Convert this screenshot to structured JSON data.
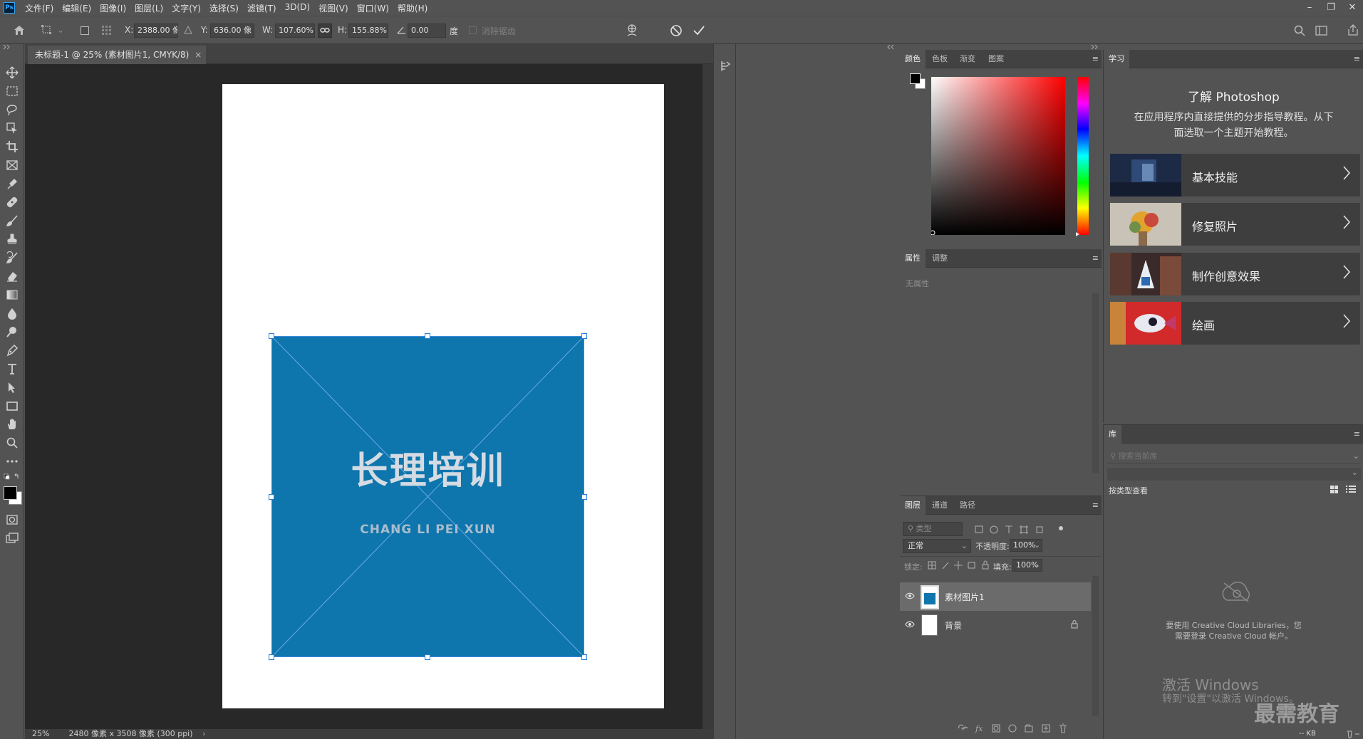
{
  "menubar": {
    "app_icon": "Ps",
    "items": [
      "文件(F)",
      "编辑(E)",
      "图像(I)",
      "图层(L)",
      "文字(Y)",
      "选择(S)",
      "滤镜(T)",
      "3D(D)",
      "视图(V)",
      "窗口(W)",
      "帮助(H)"
    ],
    "window_controls": [
      "minimize-icon",
      "restore-icon",
      "close-icon"
    ]
  },
  "options": {
    "x_label": "X:",
    "x_value": "2388.00 像",
    "y_label": "Y:",
    "y_value": "636.00 像",
    "w_label": "W:",
    "w_value": "107.60%",
    "h_label": "H:",
    "h_value": "155.88%",
    "angle_value": "0.00",
    "angle_unit": "度",
    "antialias_label": "消除锯齿"
  },
  "document": {
    "tab_title": "未标题-1 @ 25% (素材图片1, CMYK/8)",
    "logo_title": "长理培训",
    "logo_subtitle": "CHANG LI PEI XUN"
  },
  "status": {
    "zoom": "25%",
    "doc_info": "2480 像素 x 3508 像素 (300 ppi)"
  },
  "color_panel": {
    "tabs": [
      "颜色",
      "色板",
      "渐变",
      "图案"
    ],
    "foreground": "#000000",
    "background": "#ffffff",
    "hue": "#ff0000"
  },
  "properties_panel": {
    "tabs": [
      "属性",
      "调整"
    ],
    "empty_text": "无属性"
  },
  "layers_panel": {
    "tabs": [
      "图层",
      "通道",
      "路径"
    ],
    "filter_placeholder": "类型",
    "blend_mode": "正常",
    "opacity_label": "不透明度:",
    "opacity_value": "100%",
    "lock_label": "锁定:",
    "fill_label": "填充:",
    "fill_value": "100%",
    "layers": [
      {
        "name": "素材图片1",
        "selected": true
      },
      {
        "name": "背景",
        "selected": false,
        "locked": true
      }
    ]
  },
  "learn_panel": {
    "tab": "学习",
    "heading": "了解 Photoshop",
    "description_line1": "在应用程序内直接提供的分步指导教程。从下",
    "description_line2": "面选取一个主题开始教程。",
    "cards": [
      "基本技能",
      "修复照片",
      "制作创意效果",
      "绘画"
    ]
  },
  "library_panel": {
    "tab": "库",
    "search_placeholder": "搜索当前库",
    "view_label": "按类型查看",
    "cc_text_line1": "要使用 Creative Cloud Libraries，您",
    "cc_text_line2": "需要登录 Creative Cloud 帐户。",
    "size_label": "-- KB"
  },
  "overlay": {
    "activate_line1": "激活 Windows",
    "activate_line2": "转到\"设置\"以激活 Windows。",
    "watermark": "最需教育"
  }
}
